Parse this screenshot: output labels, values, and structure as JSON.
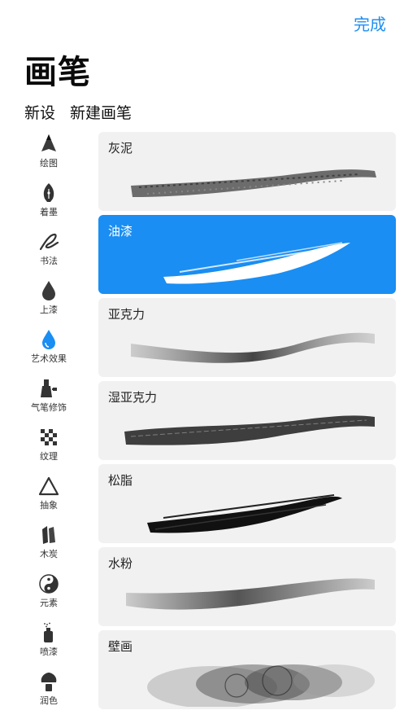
{
  "header": {
    "done_label": "完成",
    "title": "画笔"
  },
  "actions": {
    "preset_label": "新设",
    "new_brush_label": "新建画笔"
  },
  "sidebar": {
    "items": [
      {
        "label": "绘图",
        "icon": "pencil-tip-icon"
      },
      {
        "label": "着墨",
        "icon": "fountain-pen-icon"
      },
      {
        "label": "书法",
        "icon": "calligraphy-icon"
      },
      {
        "label": "上漆",
        "icon": "paint-drop-icon"
      },
      {
        "label": "艺术效果",
        "icon": "artistic-drop-icon",
        "active": true
      },
      {
        "label": "气笔修饰",
        "icon": "airbrush-icon"
      },
      {
        "label": "纹理",
        "icon": "texture-checker-icon"
      },
      {
        "label": "抽象",
        "icon": "triangle-icon"
      },
      {
        "label": "木炭",
        "icon": "charcoal-icon"
      },
      {
        "label": "元素",
        "icon": "yin-yang-icon"
      },
      {
        "label": "喷漆",
        "icon": "spray-can-icon"
      },
      {
        "label": "润色",
        "icon": "blend-brush-icon"
      }
    ]
  },
  "brushes": [
    {
      "name": "灰泥",
      "selected": false
    },
    {
      "name": "油漆",
      "selected": true
    },
    {
      "name": "亚克力",
      "selected": false
    },
    {
      "name": "湿亚克力",
      "selected": false
    },
    {
      "name": "松脂",
      "selected": false
    },
    {
      "name": "水粉",
      "selected": false
    },
    {
      "name": "壁画",
      "selected": false
    }
  ],
  "colors": {
    "accent": "#1a8ef2",
    "item_bg": "#f1f1f1",
    "text": "#111111"
  }
}
